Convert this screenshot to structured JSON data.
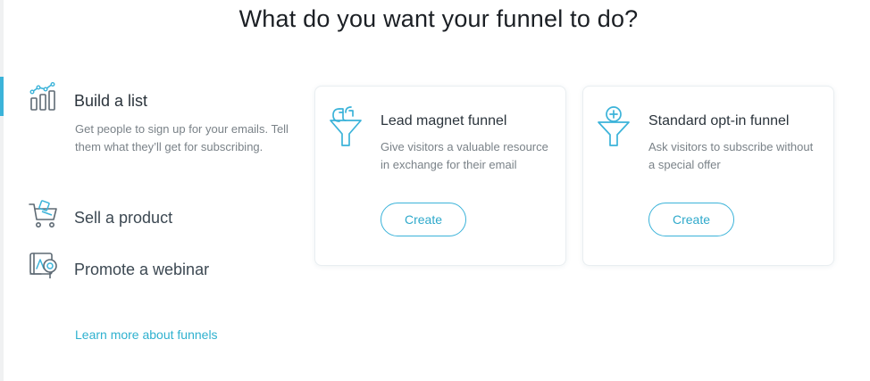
{
  "page": {
    "title": "What do you want your funnel to do?"
  },
  "goals": [
    {
      "label": "Build a list",
      "icon": "bar-chart-growth-icon",
      "active": true,
      "description": "Get people to sign up for your emails. Tell them what they’ll get for subscribing."
    },
    {
      "label": "Sell a product",
      "icon": "shopping-cart-icon",
      "active": false
    },
    {
      "label": "Promote a webinar",
      "icon": "webinar-icon",
      "active": false
    }
  ],
  "learn_more": {
    "label": "Learn more about funnels"
  },
  "funnels": [
    {
      "title": "Lead magnet funnel",
      "icon": "magnet-funnel-icon",
      "description": "Give visitors a valuable resource in exchange for their email",
      "button_label": "Create"
    },
    {
      "title": "Standard opt-in funnel",
      "icon": "opt-in-funnel-icon",
      "description": "Ask visitors to subscribe without a special offer",
      "button_label": "Create"
    }
  ],
  "colors": {
    "accent": "#3bb3d9",
    "link": "#2fb1cf",
    "icon_stroke": "#5e6a74",
    "funnel_icon": "#3bb3d9"
  }
}
